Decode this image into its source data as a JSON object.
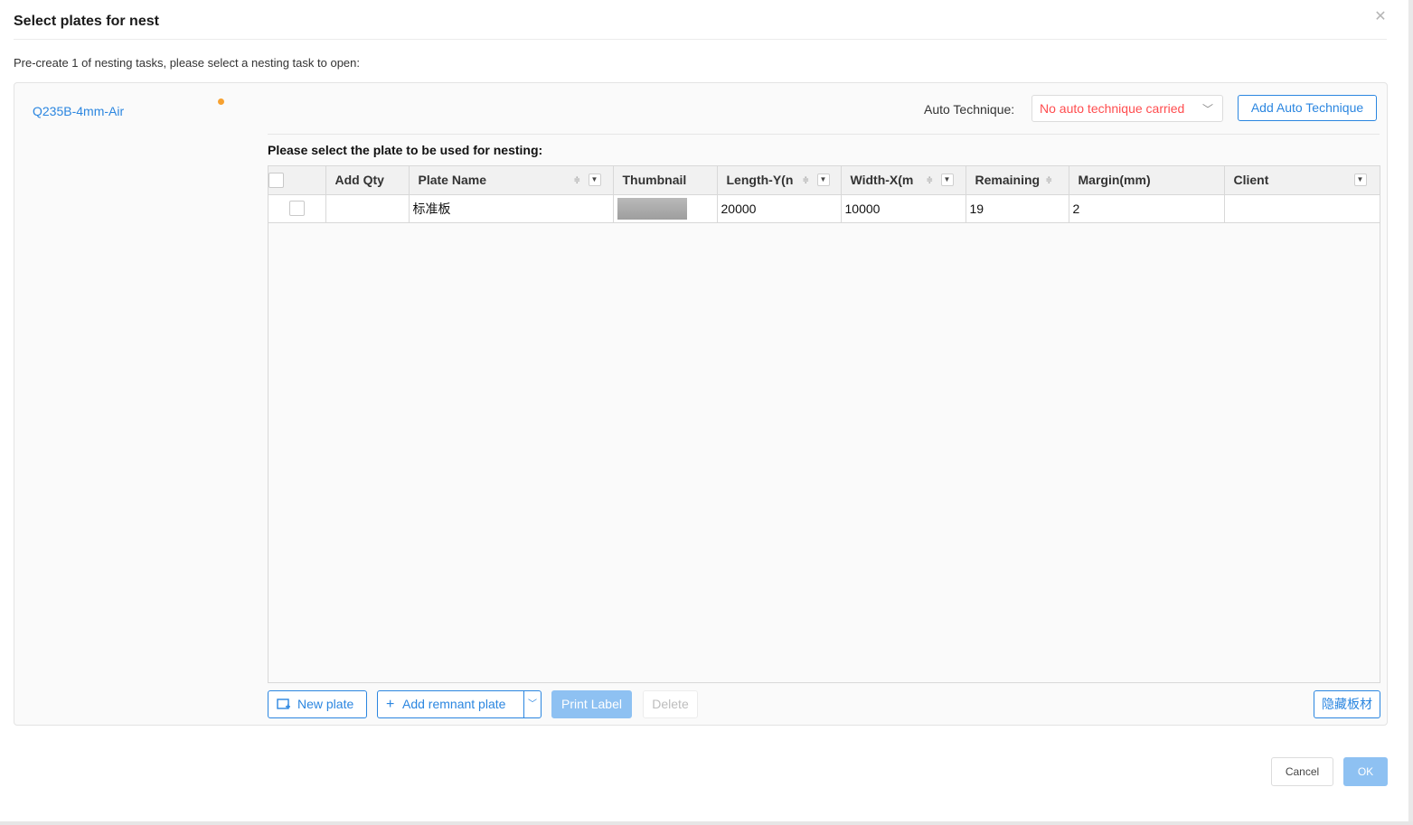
{
  "dialog": {
    "title": "Select plates for nest",
    "subtitle": "Pre-create 1 of nesting tasks, please select a nesting task to open:"
  },
  "tasks": [
    {
      "label": "Q235B-4mm-Air",
      "status_color": "#f7a130"
    }
  ],
  "technique": {
    "label": "Auto Technique:",
    "value": "No auto technique carried",
    "value_color": "#ff4d4f",
    "add_button": "Add Auto Technique"
  },
  "grid": {
    "title": "Please select the plate to be used for nesting:",
    "columns": [
      "Add Qty",
      "Plate Name",
      "Thumbnail",
      "Length-Y(n",
      "Width-X(m",
      "Remaining",
      "Margin(mm)",
      "Client"
    ],
    "rows": [
      {
        "add_qty": "",
        "plate_name": "标准板",
        "thumbnail": "plate-thumbnail",
        "length": "20000",
        "width": "10000",
        "remaining": "19",
        "margin": "2",
        "client": ""
      }
    ]
  },
  "toolbar": {
    "new_plate": "New plate",
    "add_remnant": "Add remnant plate",
    "print_label": "Print Label",
    "delete": "Delete",
    "hide_plates": "隐藏板材"
  },
  "footer": {
    "cancel": "Cancel",
    "ok": "OK"
  },
  "colors": {
    "accent": "#2b86e0",
    "accent_disabled": "#8ec1f2"
  }
}
